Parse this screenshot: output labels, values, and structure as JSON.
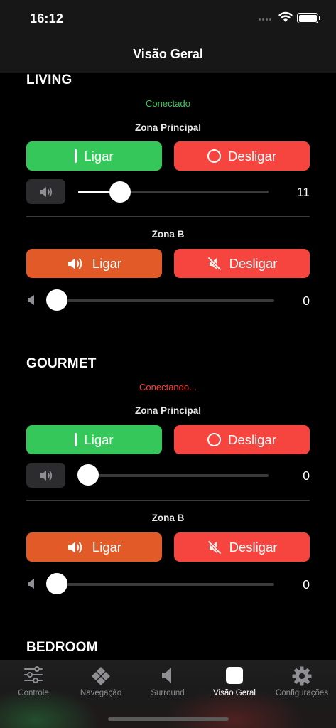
{
  "status_bar": {
    "time": "16:12"
  },
  "nav": {
    "title": "Visão Geral"
  },
  "sections": [
    {
      "title": "LIVING",
      "status": "Conectado",
      "status_color": "#34c759",
      "zones": [
        {
          "title": "Zona Principal",
          "on_label": "Ligar",
          "off_label": "Desligar",
          "volume": 11,
          "volume_max": 50
        },
        {
          "title": "Zona B",
          "on_label": "Ligar",
          "off_label": "Desligar",
          "volume": 0,
          "volume_max": 50
        }
      ]
    },
    {
      "title": "GOURMET",
      "status": "Conectando...",
      "status_color": "#ff3b30",
      "zones": [
        {
          "title": "Zona Principal",
          "on_label": "Ligar",
          "off_label": "Desligar",
          "volume": 0,
          "volume_max": 50
        },
        {
          "title": "Zona B",
          "on_label": "Ligar",
          "off_label": "Desligar",
          "volume": 0,
          "volume_max": 50
        }
      ]
    },
    {
      "title": "BEDROOM"
    }
  ],
  "tabs": [
    {
      "label": "Controle",
      "icon": "sliders-icon",
      "active": false
    },
    {
      "label": "Navegação",
      "icon": "gamepad-icon",
      "active": false
    },
    {
      "label": "Surround",
      "icon": "speaker-icon",
      "active": false
    },
    {
      "label": "Visão Geral",
      "icon": "square-icon",
      "active": true
    },
    {
      "label": "Configurações",
      "icon": "gear-icon",
      "active": false
    }
  ]
}
